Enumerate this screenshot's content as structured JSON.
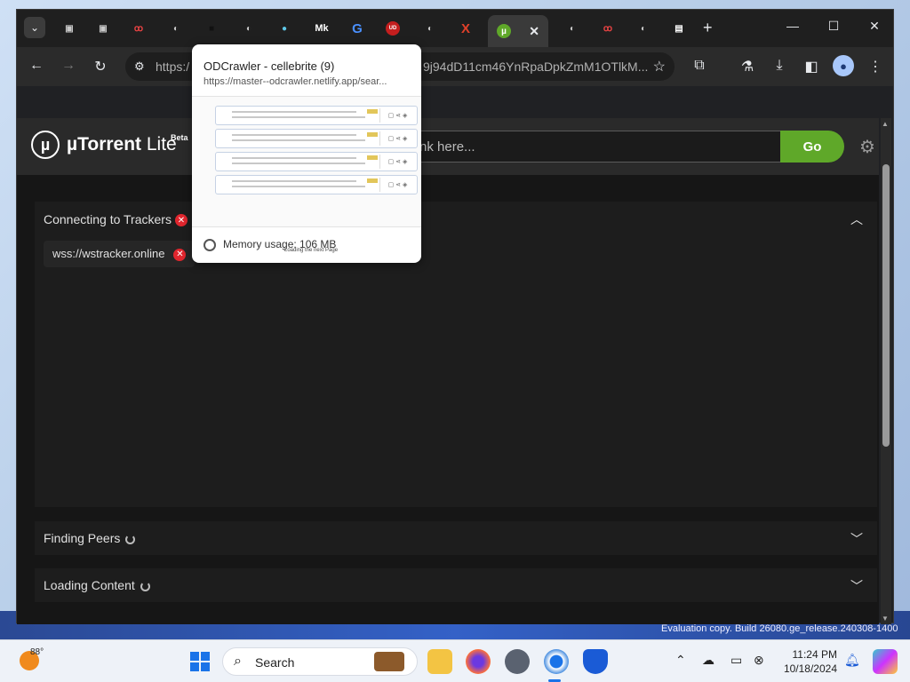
{
  "tabs": [
    {
      "icon": "checkbox-icon",
      "glyph": "▣"
    },
    {
      "icon": "checkbox-icon",
      "glyph": "▣"
    },
    {
      "icon": "glasses-icon",
      "glyph": "ꝏ"
    },
    {
      "icon": "globe-icon",
      "glyph": "◐"
    },
    {
      "icon": "dark-square-icon",
      "glyph": "■"
    },
    {
      "icon": "globe-icon",
      "glyph": "◐"
    },
    {
      "icon": "blue-circle-icon",
      "glyph": "●"
    },
    {
      "icon": "mk-icon",
      "glyph": "Mk"
    },
    {
      "icon": "g-icon",
      "glyph": "G"
    },
    {
      "icon": "ublock-icon",
      "glyph": "UD"
    },
    {
      "icon": "globe-icon",
      "glyph": "◐"
    },
    {
      "icon": "x-icon",
      "glyph": "X"
    },
    {
      "icon": "utorrent-icon",
      "glyph": "µ"
    },
    {
      "icon": "globe-icon",
      "glyph": "◐"
    },
    {
      "icon": "glasses-icon",
      "glyph": "ꝏ"
    },
    {
      "icon": "globe-icon",
      "glyph": "◐"
    },
    {
      "icon": "document-icon",
      "glyph": "▤"
    }
  ],
  "window_controls": {
    "minimize": "—",
    "maximize": "☐",
    "close": "✕"
  },
  "address_bar": {
    "url_start": "https:/",
    "url_end": "9j94dD11cm46YnRpaDpkZmM1OTlkM..."
  },
  "hover_card": {
    "title": "ODCrawler - cellebrite (9)",
    "url": "https://master--odcrawler.netlify.app/sear...",
    "loading_text": "Loading the next Page",
    "memory_usage": "Memory usage: 106 MB"
  },
  "app": {
    "brand_prefix": "µ",
    "brand_bold": "µTorrent",
    "brand_light": " Lite",
    "brand_badge": "Beta",
    "search_placeholder": "nk here...",
    "go_label": "Go"
  },
  "panels": {
    "trackers": {
      "title": "Connecting to Trackers",
      "tracker": "wss://wstracker.online"
    },
    "peers": {
      "title": "Finding Peers"
    },
    "content": {
      "title": "Loading Content"
    }
  },
  "desktop": {
    "evaluation_text": "Evaluation copy. Build 26080.ge_release.240308-1400"
  },
  "taskbar": {
    "temperature": "88°",
    "search_label": "Search",
    "time": "11:24 PM",
    "date": "10/18/2024"
  },
  "colors": {
    "go_button": "#5fa829",
    "error_red": "#e0262e",
    "page_bg": "#161616",
    "accent_blue": "#1a73e8"
  }
}
